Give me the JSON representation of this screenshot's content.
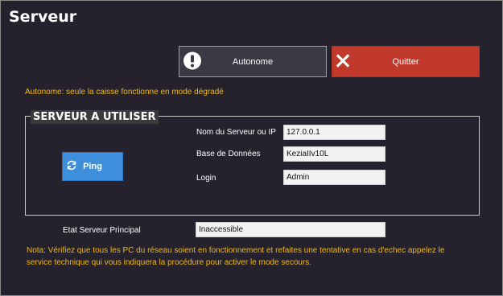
{
  "window": {
    "title": "Serveur"
  },
  "toolbar": {
    "autonome_label": "Autonome",
    "quitter_label": "Quitter"
  },
  "hint": "Autonome: seule la caisse fonctionne en mode dégradé",
  "group": {
    "legend": "SERVEUR A UTILISER",
    "ping_label": "Ping",
    "server_label": "Nom du Serveur ou IP",
    "server_value": "127.0.0.1",
    "db_label": "Base de Données",
    "db_value": "KeziaIIv10L",
    "login_label": "Login",
    "login_value": "Admin"
  },
  "status": {
    "label": "Etat Serveur Principal",
    "value": "Inaccessible"
  },
  "note": "Nota: Vérifiez que tous les PC du réseau soient en fonctionnement et refaites une tentative en cas d'echec appelez le service technique qui vous indiquera la procédure pour activer le mode secours.",
  "colors": {
    "background": "#25222e",
    "quit": "#c0392b",
    "ping": "#3d8fdc",
    "warning_text": "#f0b816"
  },
  "icons": {
    "autonome": "exclamation-circle-icon",
    "quitter": "close-x-icon",
    "ping": "refresh-icon"
  }
}
